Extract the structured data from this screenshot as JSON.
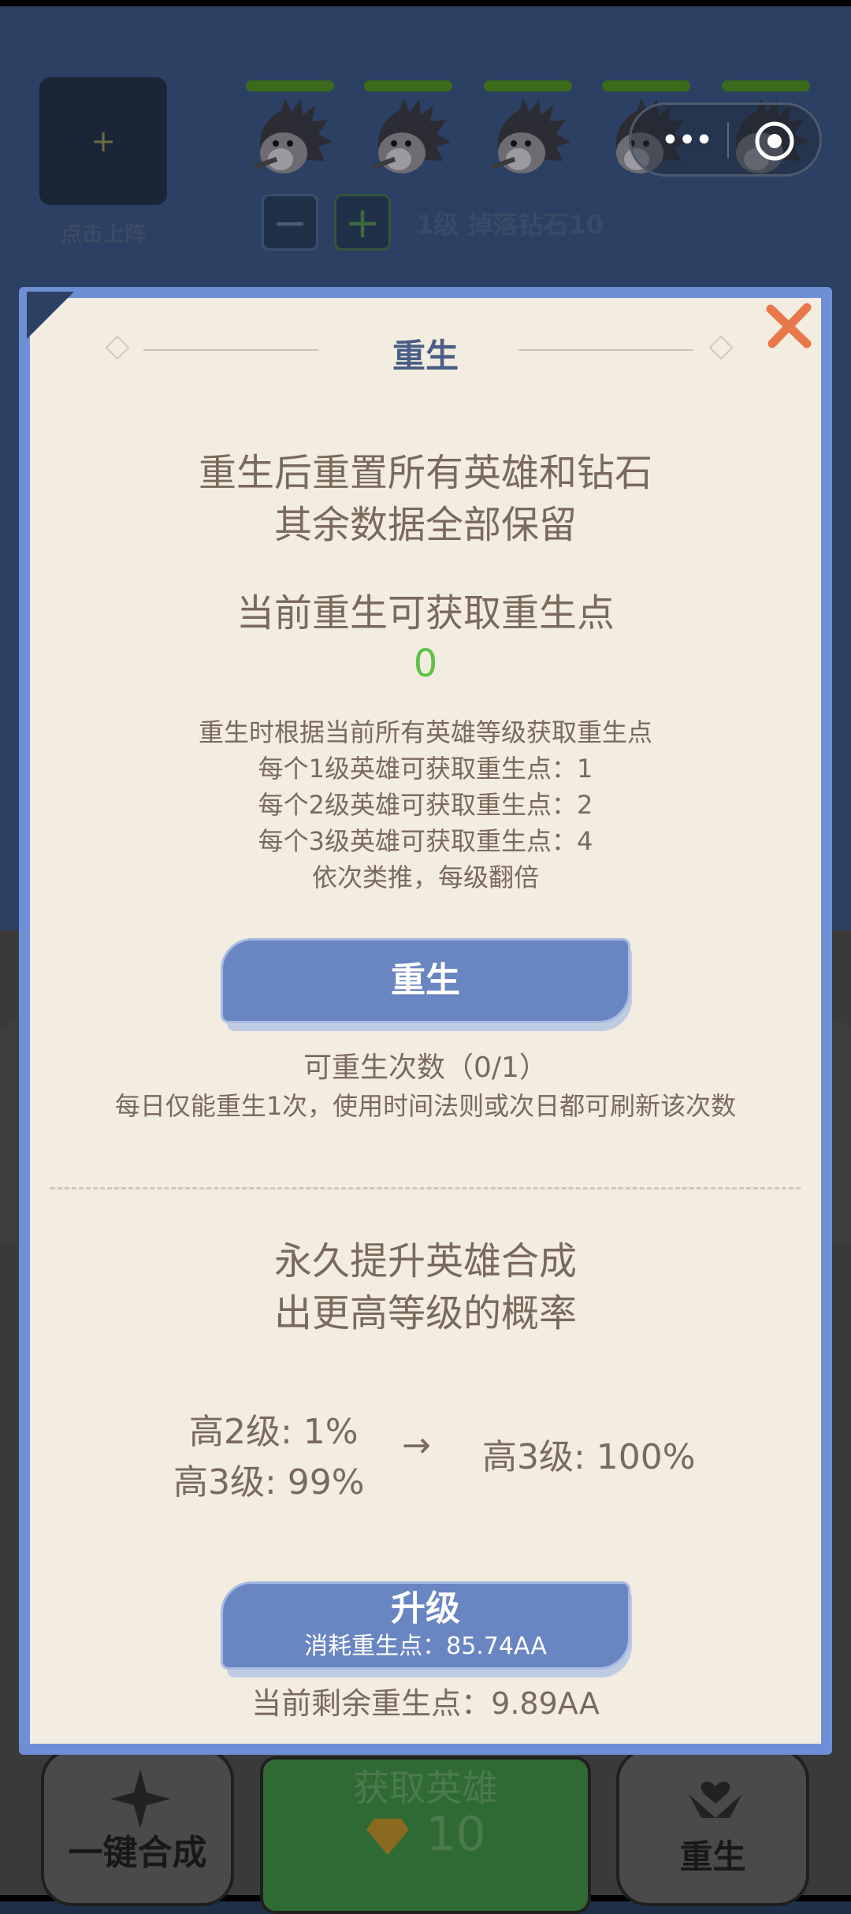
{
  "top_bar": {
    "slot_plus": "+",
    "slot_label": "点击上阵",
    "minus_label": "−",
    "plus_label": "+",
    "level_drop_text": "1级 掉落钻石10",
    "hero_slots": 5,
    "capsule_dots": "•••"
  },
  "dialog": {
    "title": "重生",
    "close_icon": "close-icon",
    "intro_line1": "重生后重置所有英雄和钻石",
    "intro_line2": "其余数据全部保留",
    "points_heading": "当前重生可获取重生点",
    "points_value": "0",
    "rules": [
      "重生时根据当前所有英雄等级获取重生点",
      "每个1级英雄可获取重生点：1",
      "每个2级英雄可获取重生点：2",
      "每个3级英雄可获取重生点：4",
      "依次类推，每级翻倍"
    ],
    "rebirth_button": "重生",
    "rebirth_count": "可重生次数（0/1）",
    "rebirth_note": "每日仅能重生1次，使用时间法则或次日都可刷新该次数",
    "upgrade_heading_line1": "永久提升英雄合成",
    "upgrade_heading_line2": "出更高等级的概率",
    "current_probs": [
      "高2级: 1%",
      "高3级: 99%"
    ],
    "arrow": "→",
    "next_prob": "高3级: 100%",
    "upgrade_button": "升级",
    "upgrade_cost": "消耗重生点：85.74AA",
    "remaining_points": "当前剩余重生点：9.89AA"
  },
  "bottom_bar": {
    "merge_label": "一键合成",
    "get_hero_label": "获取英雄",
    "get_hero_cost": "10",
    "rebirth_label": "重生"
  },
  "colors": {
    "dialog_border": "#6e8fd6",
    "dialog_bg": "#f3ece0",
    "button_blue": "#6a86c2",
    "green_value": "#5cc24a",
    "close_orange": "#e8784a"
  }
}
